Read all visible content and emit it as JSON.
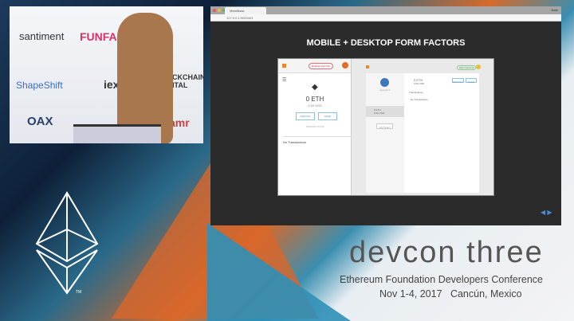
{
  "video": {
    "sponsors": [
      "santiment",
      "FUNFAIR",
      "ShapeShift",
      "iexec",
      "BLOCKCHAIN CAPITAL",
      "OAX",
      "amr"
    ]
  },
  "browser": {
    "tab_title": "MetaMask",
    "url": "127.0.0.1:9000/#/3",
    "user": "Nate"
  },
  "slide": {
    "title": "MOBILE + DESKTOP FORM FACTORS",
    "mobile": {
      "network": "Ropsten Test Net",
      "balance": "0 ETH",
      "usd": "0.00 USD",
      "deposit": "DEPOSIT",
      "send": "SEND",
      "transactions_label": "TRANSACTIONS",
      "empty": "No Transactions"
    },
    "desktop": {
      "network": "Main Network",
      "account": "Account 1",
      "balance": "0 ETH",
      "usd": "0.00 USD",
      "deposit": "DEPOSIT",
      "send": "SEND",
      "transactions_label": "Transactions",
      "empty": "No Transactions",
      "token_balance": "0 ETH",
      "token_usd": "0.00 USD",
      "add_token": "Add Token"
    }
  },
  "conference": {
    "name": "devcon three",
    "subtitle": "Ethereum Foundation Developers Conference",
    "date_location": "Nov 1-4, 2017   Cancún, Mexico",
    "tm": "TM"
  },
  "colors": {
    "accent": "#3d8fd6",
    "slide_bg": "#2b2b2b"
  }
}
